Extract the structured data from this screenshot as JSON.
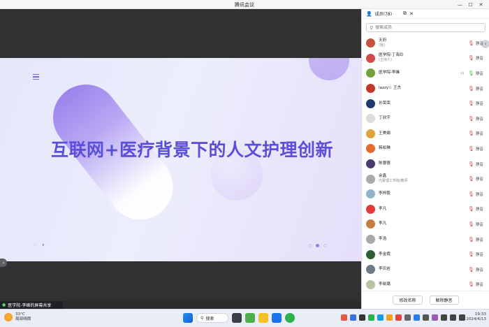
{
  "window": {
    "title": "腾讯会议",
    "min": "—",
    "max": "☐",
    "close": "✕"
  },
  "slide": {
    "title": "互联网+医疗背景下的人文护理创新",
    "prev": "‹",
    "next": "›"
  },
  "sharer": {
    "label": "医学院-李峰的屏幕共享"
  },
  "panel": {
    "tab_label": "成员(78)",
    "search_placeholder": "搜索成员",
    "action_label": "静音",
    "members": [
      {
        "name": "天府",
        "sub": "(我)",
        "color": "#c4533e"
      },
      {
        "name": "医学院-丁海玲",
        "sub": "(主持人)",
        "color": "#d24a4a"
      },
      {
        "name": "医学院-李峰",
        "sub": "",
        "color": "#74a23a",
        "mic_on": true,
        "camera": true
      },
      {
        "name": "lazzy☆ 王杰",
        "sub": "",
        "color": "#c0392b"
      },
      {
        "name": "孙荣荣",
        "sub": "",
        "color": "#1f3b6e"
      },
      {
        "name": "丁欣宇",
        "sub": "",
        "color": "#dcdcdc"
      },
      {
        "name": "王美娟",
        "sub": "",
        "color": "#e0a33b"
      },
      {
        "name": "韩如琳",
        "sub": "",
        "color": "#e46b2a"
      },
      {
        "name": "陈蓉蓉",
        "sub": "",
        "color": "#4b3a6e"
      },
      {
        "name": "余鑫",
        "sub": "内蒙理工学院/教师",
        "color": "#aaaaaa"
      },
      {
        "name": "李梓毅",
        "sub": "",
        "color": "#8fb3c8"
      },
      {
        "name": "李凡",
        "sub": "",
        "color": "#e33b3b"
      },
      {
        "name": "李凡",
        "sub": "",
        "color": "#c47d45"
      },
      {
        "name": "李浩",
        "sub": "",
        "color": "#a8a8a8"
      },
      {
        "name": "李金霞",
        "sub": "",
        "color": "#2e5e34"
      },
      {
        "name": "李庆岩",
        "sub": "",
        "color": "#6d7b89"
      },
      {
        "name": "李晓璐",
        "sub": "",
        "color": "#b6c3a5"
      }
    ],
    "rename_btn": "修改名称",
    "unmute_btn": "解除静音"
  },
  "taskbar": {
    "temp": "33°C",
    "weather": "局部晴朗",
    "search": "搜索",
    "time": "19:33",
    "date": "2024/4/13"
  }
}
